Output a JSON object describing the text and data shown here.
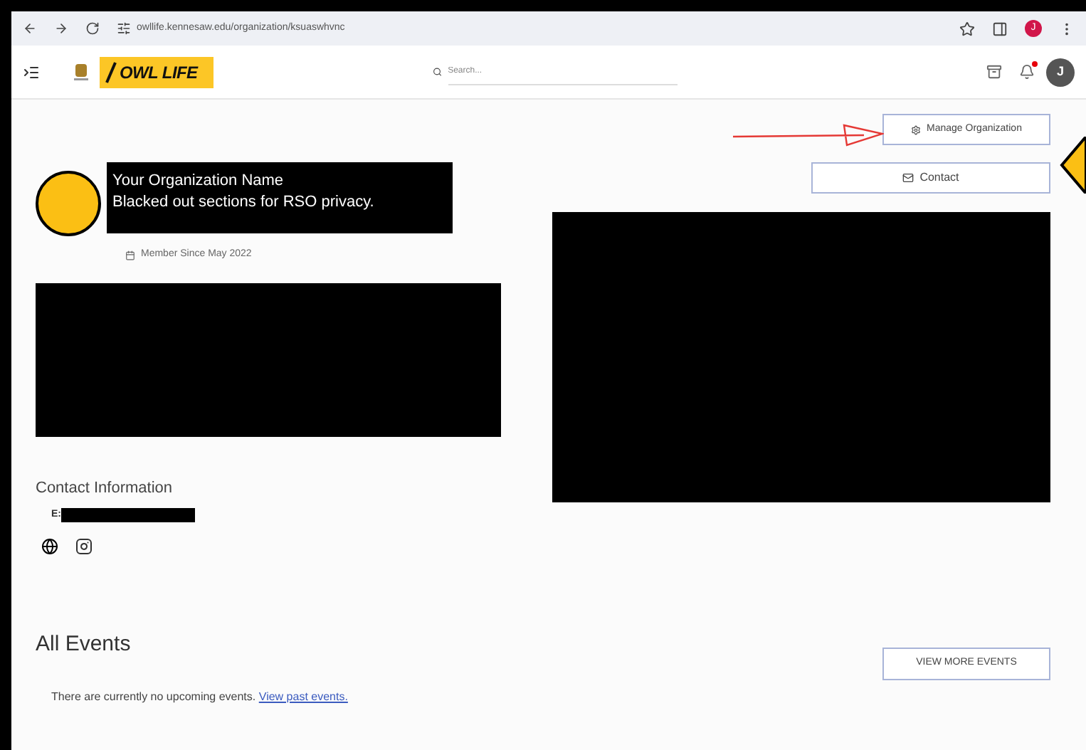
{
  "browser": {
    "url": "owllife.kennesaw.edu/organization/ksuaswhvnc",
    "profile_initial": "J"
  },
  "header": {
    "logo_text": "OWL LIFE",
    "search": {
      "placeholder": "Search..."
    },
    "avatar_initial": "J"
  },
  "actions": {
    "manage": "Manage Organization",
    "contact": "Contact"
  },
  "organization": {
    "name": "Your Organization Name",
    "note": "Blacked out sections for RSO privacy.",
    "member_since": "Member Since May 2022"
  },
  "contact": {
    "heading": "Contact Information",
    "email_label": "E:"
  },
  "events": {
    "heading": "All Events",
    "more_button": "VIEW MORE EVENTS",
    "message": "There are currently no upcoming events.",
    "link": "View past events."
  }
}
